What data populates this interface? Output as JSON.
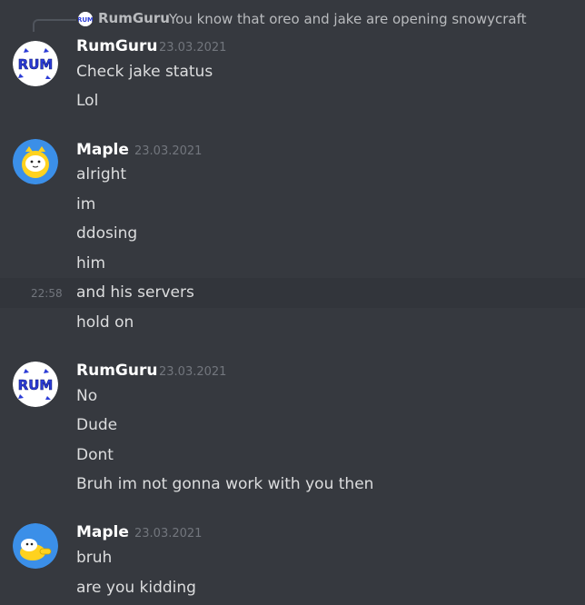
{
  "reply": {
    "author": "RumGuru",
    "text": "You know that oreo and jake are opening snowycraft"
  },
  "groups": [
    {
      "author": "RumGuru",
      "timestamp": "23.03.2021",
      "avatar": "rumguru-avatar",
      "messages": [
        "Check jake status",
        "Lol"
      ]
    },
    {
      "author": "Maple",
      "timestamp": "23.03.2021",
      "avatar": "maple-avatar",
      "messages": [
        "alright",
        "im",
        "ddosing",
        "him",
        "and his servers",
        "hold on"
      ],
      "hover_time": "22:58"
    },
    {
      "author": "RumGuru",
      "timestamp": "23.03.2021",
      "avatar": "rumguru-avatar",
      "messages": [
        "No",
        "Dude",
        "Dont",
        "Bruh im not gonna work with you then"
      ]
    },
    {
      "author": "Maple",
      "timestamp": "23.03.2021",
      "avatar": "maple-avatar-2",
      "messages": [
        "bruh",
        "are you kidding"
      ]
    }
  ],
  "colors": {
    "background": "#36393f",
    "hover": "#32353b",
    "username": "#ffffff",
    "text": "#dcddde",
    "muted": "#72767d"
  }
}
